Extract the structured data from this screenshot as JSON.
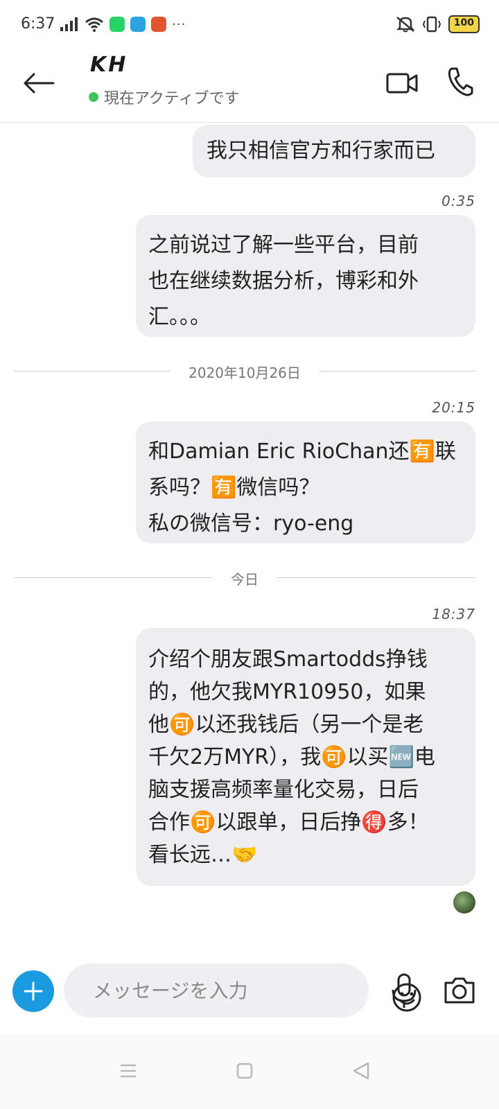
{
  "status_bar": {
    "time": "6:37",
    "more": "···",
    "battery": "100",
    "app_icons": [
      {
        "name": "whatsapp-icon",
        "color": "#25d366"
      },
      {
        "name": "telegram-icon",
        "color": "#2aa3e0"
      },
      {
        "name": "fox-app-icon",
        "color": "#e0552e"
      }
    ]
  },
  "header": {
    "contact_name": "KH",
    "presence": "現在アクティブです",
    "presence_color": "#3ec45c"
  },
  "messages": [
    {
      "type": "outgoing",
      "text": "我只相信官方和行家而已"
    },
    {
      "type": "time",
      "text": "0:35"
    },
    {
      "type": "outgoing",
      "text": "之前说过了解一些平台，目前\n也在继续数据分析，博彩和外\n汇。。。"
    },
    {
      "type": "date",
      "text": "2020年10月26日"
    },
    {
      "type": "time",
      "text": "20:15"
    },
    {
      "type": "outgoing",
      "text": "和Damian Eric RioChan还🈶联\n系吗？🈶微信吗？\n私の微信号：ryo-eng"
    },
    {
      "type": "date",
      "text": "今日"
    },
    {
      "type": "time",
      "text": "18:37"
    },
    {
      "type": "outgoing",
      "text": "介绍个朋友跟Smartodds挣钱\n的，他欠我MYR10950，如果\n他🉑以还我钱后（另一个是老\n千欠2万MYR），我🉑以买🆕电\n脑支援高频率量化交易，日后\n合作🉑以跟单，日后挣🉐多！\n看长远…🤝"
    }
  ],
  "composer": {
    "placeholder": "メッセージを入力"
  },
  "colors": {
    "accent": "#1a9be0",
    "bubble": "#eeeef1"
  }
}
